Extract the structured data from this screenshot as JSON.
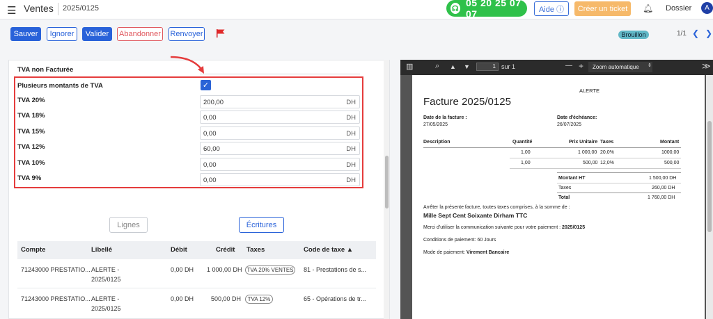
{
  "topbar": {
    "app_title": "Ventes",
    "breadcrumb": "2025/0125",
    "phone": "05 20 25 07 07",
    "aide": "Aide ⓘ",
    "ticket": "Créer un ticket",
    "dossier": "Dossier",
    "avatar": "A"
  },
  "actions": {
    "sauver": "Sauver",
    "ignorer": "Ignorer",
    "valider": "Valider",
    "abandonner": "Abandonner",
    "renvoyer": "Renvoyer",
    "status": "Brouillon",
    "pager": "1/1"
  },
  "form": {
    "tva_non_facturee": "TVA non Facturée",
    "plusieurs": "Plusieurs montants de TVA",
    "fields": [
      {
        "label": "TVA 20%",
        "value": "200,00",
        "unit": "DH"
      },
      {
        "label": "TVA 18%",
        "value": "0,00",
        "unit": "DH"
      },
      {
        "label": "TVA 15%",
        "value": "0,00",
        "unit": "DH"
      },
      {
        "label": "TVA 12%",
        "value": "60,00",
        "unit": "DH"
      },
      {
        "label": "TVA 10%",
        "value": "0,00",
        "unit": "DH"
      },
      {
        "label": "TVA 9%",
        "value": "0,00",
        "unit": "DH"
      }
    ]
  },
  "tabs": {
    "lignes": "Lignes",
    "ecritures": "Écritures"
  },
  "table": {
    "headers": [
      "Compte",
      "Libellé",
      "Débit",
      "Crédit",
      "Taxes",
      "Code de taxe ▲"
    ],
    "rows": [
      {
        "compte": "71243000 PRESTATIO...",
        "libelle1": "ALERTE -",
        "libelle2": "2025/0125",
        "debit": "0,00 DH",
        "credit": "1 000,00 DH",
        "taxe": "TVA 20% VENTES",
        "code": "81 - Prestations de s..."
      },
      {
        "compte": "71243000 PRESTATIO...",
        "libelle1": "ALERTE -",
        "libelle2": "2025/0125",
        "debit": "0,00 DH",
        "credit": "500,00 DH",
        "taxe": "TVA 12%",
        "code": "65 - Opérations de tr..."
      }
    ]
  },
  "viewer": {
    "page_num": "1",
    "page_of": "sur 1",
    "zoom": "Zoom automatique",
    "minus": "—",
    "plus": "+",
    "more": "≫"
  },
  "invoice": {
    "company": "ALERTE",
    "title": "Facture 2025/0125",
    "date_label": "Date de la facture :",
    "date_value": "27/05/2025",
    "due_label": "Date d'échéance:",
    "due_value": "26/07/2025",
    "col_desc": "Description",
    "col_qty": "Quantité",
    "col_pu": "Prix Unitaire",
    "col_tax": "Taxes",
    "col_amt": "Montant",
    "lines": [
      {
        "qty": "1,00",
        "pu": "1 000,00",
        "tax": "20,0%",
        "amt": "1000,00"
      },
      {
        "qty": "1,00",
        "pu": "500,00",
        "tax": "12,0%",
        "amt": "500,00"
      }
    ],
    "ht_label": "Montant HT",
    "ht_value": "1 500,00 DH",
    "taxes_label": "Taxes",
    "taxes_value": "260,00 DH",
    "total_label": "Total",
    "total_value": "1 760,00 DH",
    "arrete": "Arrêter la présente facture, toutes taxes comprises, à la somme de :",
    "amount_words": "Mille Sept Cent Soixante Dirham TTC",
    "comm_text": "Merci d'utiliser la communication suivante pour votre paiement :",
    "comm_ref": "2025/0125",
    "conditions": "Conditions de paiement: 60 Jours",
    "mode_text": "Mode de paiement:",
    "mode_value": "Virement Bancaire"
  },
  "colors": {
    "primary": "#2962d9",
    "highlight": "#e53c3c",
    "phone": "#2fc14a",
    "ticket": "#f6b96a"
  }
}
